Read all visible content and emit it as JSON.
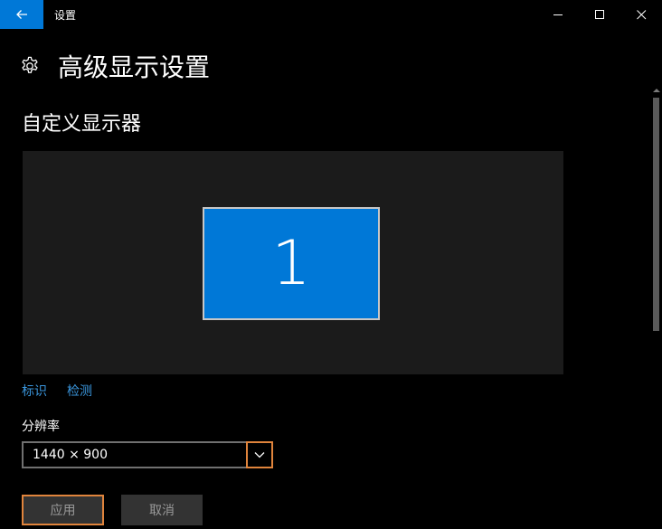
{
  "window": {
    "title": "设置",
    "back_icon": "back-arrow-icon",
    "minimize_icon": "minimize-icon",
    "maximize_icon": "maximize-icon",
    "close_icon": "close-icon"
  },
  "header": {
    "icon": "gear-icon",
    "title": "高级显示设置"
  },
  "display_section": {
    "title": "自定义显示器",
    "monitor_label": "1",
    "identify_link": "标识",
    "detect_link": "检测"
  },
  "resolution": {
    "label": "分辨率",
    "selected": "1440 × 900"
  },
  "buttons": {
    "apply": "应用",
    "cancel": "取消"
  },
  "colors": {
    "accent": "#0078d7",
    "highlight": "#e0843c",
    "link": "#3a96dd"
  }
}
